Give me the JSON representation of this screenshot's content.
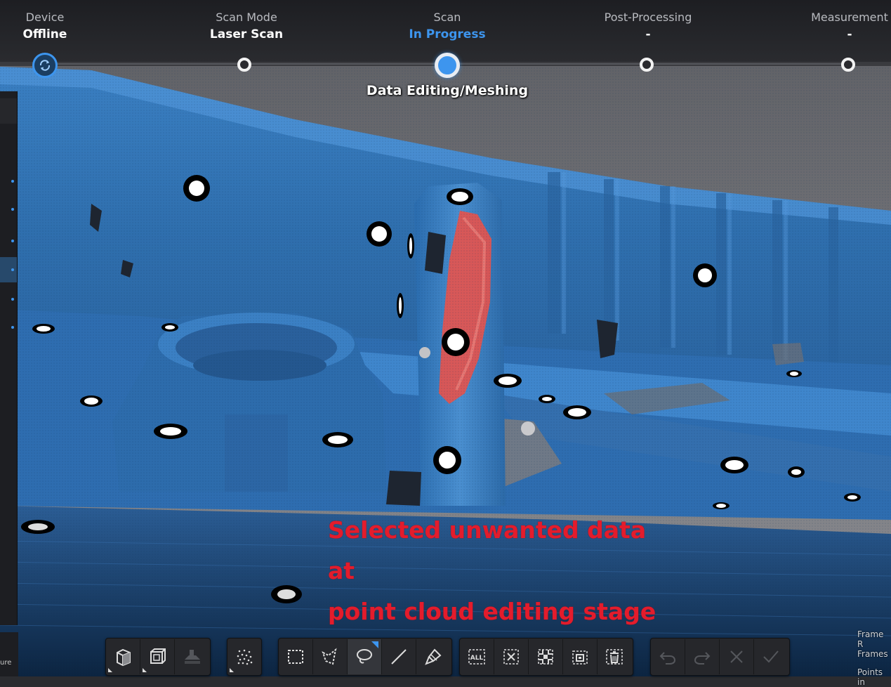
{
  "progress": {
    "steps": [
      {
        "title": "Device",
        "value": "Offline"
      },
      {
        "title": "Scan Mode",
        "value": "Laser Scan"
      },
      {
        "title": "Scan",
        "value": "In Progress"
      },
      {
        "title": "Post-Processing",
        "value": "-"
      },
      {
        "title": "Measurement",
        "value": "-"
      }
    ],
    "active_step": 2,
    "substage_label": "Data Editing/Meshing"
  },
  "annotation": {
    "line1": "Selected unwanted data at",
    "line2": "point cloud editing stage"
  },
  "bottom_right": {
    "label1": "Frame R",
    "label2": "Frames",
    "label3": "Points in"
  },
  "left_panel": {
    "clipped_label": "ure"
  },
  "toolbar": {
    "view_group": [
      "perspective-view-icon",
      "orthographic-view-icon",
      "plane-view-icon"
    ],
    "point_group": [
      "point-cloud-icon"
    ],
    "select_group": [
      "rect-select-icon",
      "polygon-select-icon",
      "lasso-select-icon",
      "line-select-icon",
      "brush-select-icon"
    ],
    "action_group": [
      "select-all-icon",
      "deselect-icon",
      "invert-selection-icon",
      "select-connected-icon",
      "delete-icon"
    ],
    "history_group": [
      "undo-icon",
      "redo-icon",
      "cancel-icon",
      "confirm-icon"
    ],
    "select_all_label": "ALL"
  },
  "colors": {
    "accent": "#3d95ee",
    "scan_blue": "#2e6fb0",
    "selection_red": "#e4544e",
    "annotation_red": "#e31c2c"
  }
}
